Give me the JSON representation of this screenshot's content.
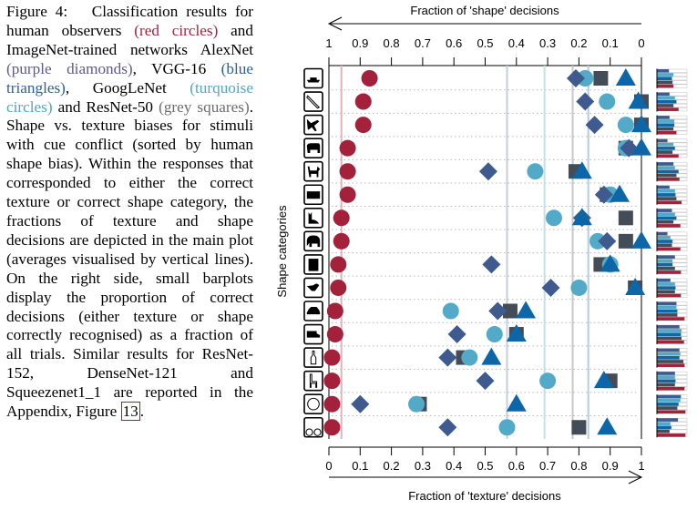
{
  "caption": {
    "figure_label": "Figure 4:",
    "parts": [
      {
        "text": "Classification results for human observers ",
        "color": null
      },
      {
        "text": "(red circles)",
        "color": "red"
      },
      {
        "text": " and ImageNet-trained networks AlexNet ",
        "color": null
      },
      {
        "text": "(purple diamonds)",
        "color": "purple"
      },
      {
        "text": ", VGG-16 ",
        "color": null
      },
      {
        "text": "(blue triangles)",
        "color": "blue"
      },
      {
        "text": ", GoogLeNet ",
        "color": null
      },
      {
        "text": "(turquoise circles)",
        "color": "turq"
      },
      {
        "text": " and ResNet-50 ",
        "color": null
      },
      {
        "text": "(grey squares)",
        "color": "grey"
      },
      {
        "text": ". Shape vs. texture biases for stimuli with cue conflict (sorted by human shape bias). Within the responses that corresponded to either the correct texture or correct shape category, the fractions of texture and shape decisions are depicted in the main plot (averages visualised by vertical lines). On the right side, small barplots display the proportion of correct decisions (either texture or shape correctly recognised) as a fraction of all trials. Similar results for ResNet-152, DenseNet-121 and Squeezenet1_1 are reported in the Appendix, Figure ",
        "color": null
      },
      {
        "text": "13",
        "color": "ref"
      },
      {
        "text": ".",
        "color": null
      }
    ]
  },
  "chart_data": {
    "type": "scatter",
    "title": "",
    "xlabel": "Fraction of 'texture' decisions",
    "x2label": "Fraction of 'shape' decisions",
    "ylabel": "Shape categories",
    "xlim": [
      0,
      1
    ],
    "x_ticks": [
      "0",
      "0.1",
      "0.2",
      "0.3",
      "0.4",
      "0.5",
      "0.6",
      "0.7",
      "0.8",
      "0.9",
      "1"
    ],
    "x2_ticks": [
      "1",
      "0.9",
      "0.8",
      "0.7",
      "0.6",
      "0.5",
      "0.4",
      "0.3",
      "0.2",
      "0.1",
      "0"
    ],
    "grid": "horizontal dotted",
    "categories": [
      "knife-boat",
      "knife",
      "airplane",
      "bear",
      "dog",
      "keyboard",
      "cat",
      "elephant",
      "oven",
      "bird",
      "car",
      "truck",
      "bottle",
      "chair",
      "clock",
      "bicycle"
    ],
    "category_icons": [
      "boat-icon",
      "knife-icon",
      "airplane-icon",
      "bear-icon",
      "dog-icon",
      "keyboard-icon",
      "cat-icon",
      "elephant-icon",
      "oven-icon",
      "bird-icon",
      "car-icon",
      "truck-icon",
      "bottle-icon",
      "chair-icon",
      "clock-icon",
      "bicycle-icon"
    ],
    "series": [
      {
        "name": "humans",
        "marker": "circle",
        "color": "#a3213a",
        "values": [
          0.13,
          0.11,
          0.11,
          0.06,
          0.06,
          0.06,
          0.04,
          0.04,
          0.03,
          0.03,
          0.02,
          0.02,
          0.01,
          0.01,
          0.01,
          0.01
        ],
        "mean": 0.04,
        "mean_color": "#e2b2bb"
      },
      {
        "name": "AlexNet",
        "marker": "diamond",
        "color": "#3f5a8e",
        "values": [
          0.79,
          0.82,
          0.85,
          0.96,
          0.51,
          0.88,
          0.81,
          0.89,
          0.52,
          0.71,
          0.54,
          0.41,
          0.38,
          0.5,
          0.1,
          0.38
        ],
        "mean": 0.57,
        "mean_color": "#c5cde0"
      },
      {
        "name": "VGG-16",
        "marker": "triangle",
        "color": "#0c66a8",
        "values": [
          0.95,
          0.99,
          1.0,
          1.0,
          0.81,
          0.93,
          0.81,
          1.0,
          0.9,
          0.98,
          0.63,
          0.6,
          0.52,
          0.88,
          0.6,
          0.89
        ],
        "mean": 0.83,
        "mean_color": "#b3cde2"
      },
      {
        "name": "GoogLeNet",
        "marker": "circle",
        "color": "#52aac8",
        "values": [
          0.82,
          0.89,
          0.95,
          0.95,
          0.66,
          0.9,
          0.72,
          0.86,
          0.9,
          0.8,
          0.39,
          0.53,
          0.45,
          0.7,
          0.28,
          0.57
        ],
        "mean": 0.69,
        "mean_color": "#c3e0e9"
      },
      {
        "name": "ResNet-50",
        "marker": "square",
        "color": "#434c57",
        "values": [
          0.87,
          1.0,
          1.0,
          0.95,
          0.79,
          0.89,
          0.95,
          0.95,
          0.87,
          0.98,
          0.58,
          0.6,
          0.43,
          0.9,
          0.29,
          0.8
        ],
        "mean": 0.78,
        "mean_color": "#c4c8cd"
      }
    ],
    "accuracy_barplots": {
      "order": [
        "AlexNet",
        "GoogLeNet",
        "VGG-16",
        "ResNet-50",
        "humans"
      ],
      "colors": [
        "#3f5a8e",
        "#52aac8",
        "#0c66a8",
        "#434c57",
        "#a3213a"
      ],
      "values": [
        [
          0.4,
          0.55,
          0.5,
          0.52,
          0.55
        ],
        [
          0.42,
          0.6,
          0.65,
          0.55,
          0.72
        ],
        [
          0.42,
          0.58,
          0.58,
          0.55,
          0.65
        ],
        [
          0.35,
          0.55,
          0.6,
          0.52,
          0.72
        ],
        [
          0.55,
          0.6,
          0.72,
          0.65,
          0.75
        ],
        [
          0.42,
          0.6,
          0.62,
          0.65,
          0.82
        ],
        [
          0.5,
          0.6,
          0.65,
          0.55,
          0.78
        ],
        [
          0.35,
          0.45,
          0.52,
          0.5,
          0.78
        ],
        [
          0.6,
          0.52,
          0.52,
          0.6,
          0.8
        ],
        [
          0.45,
          0.6,
          0.62,
          0.6,
          0.8
        ],
        [
          0.65,
          0.65,
          0.68,
          0.68,
          0.92
        ],
        [
          0.75,
          0.82,
          0.8,
          0.82,
          0.9
        ],
        [
          0.75,
          0.78,
          0.75,
          0.88,
          0.92
        ],
        [
          0.6,
          0.6,
          0.62,
          0.6,
          0.92
        ],
        [
          0.8,
          0.78,
          0.72,
          0.68,
          0.95
        ],
        [
          0.7,
          0.45,
          0.48,
          0.42,
          0.95
        ]
      ],
      "xlim": [
        0,
        1
      ]
    }
  }
}
